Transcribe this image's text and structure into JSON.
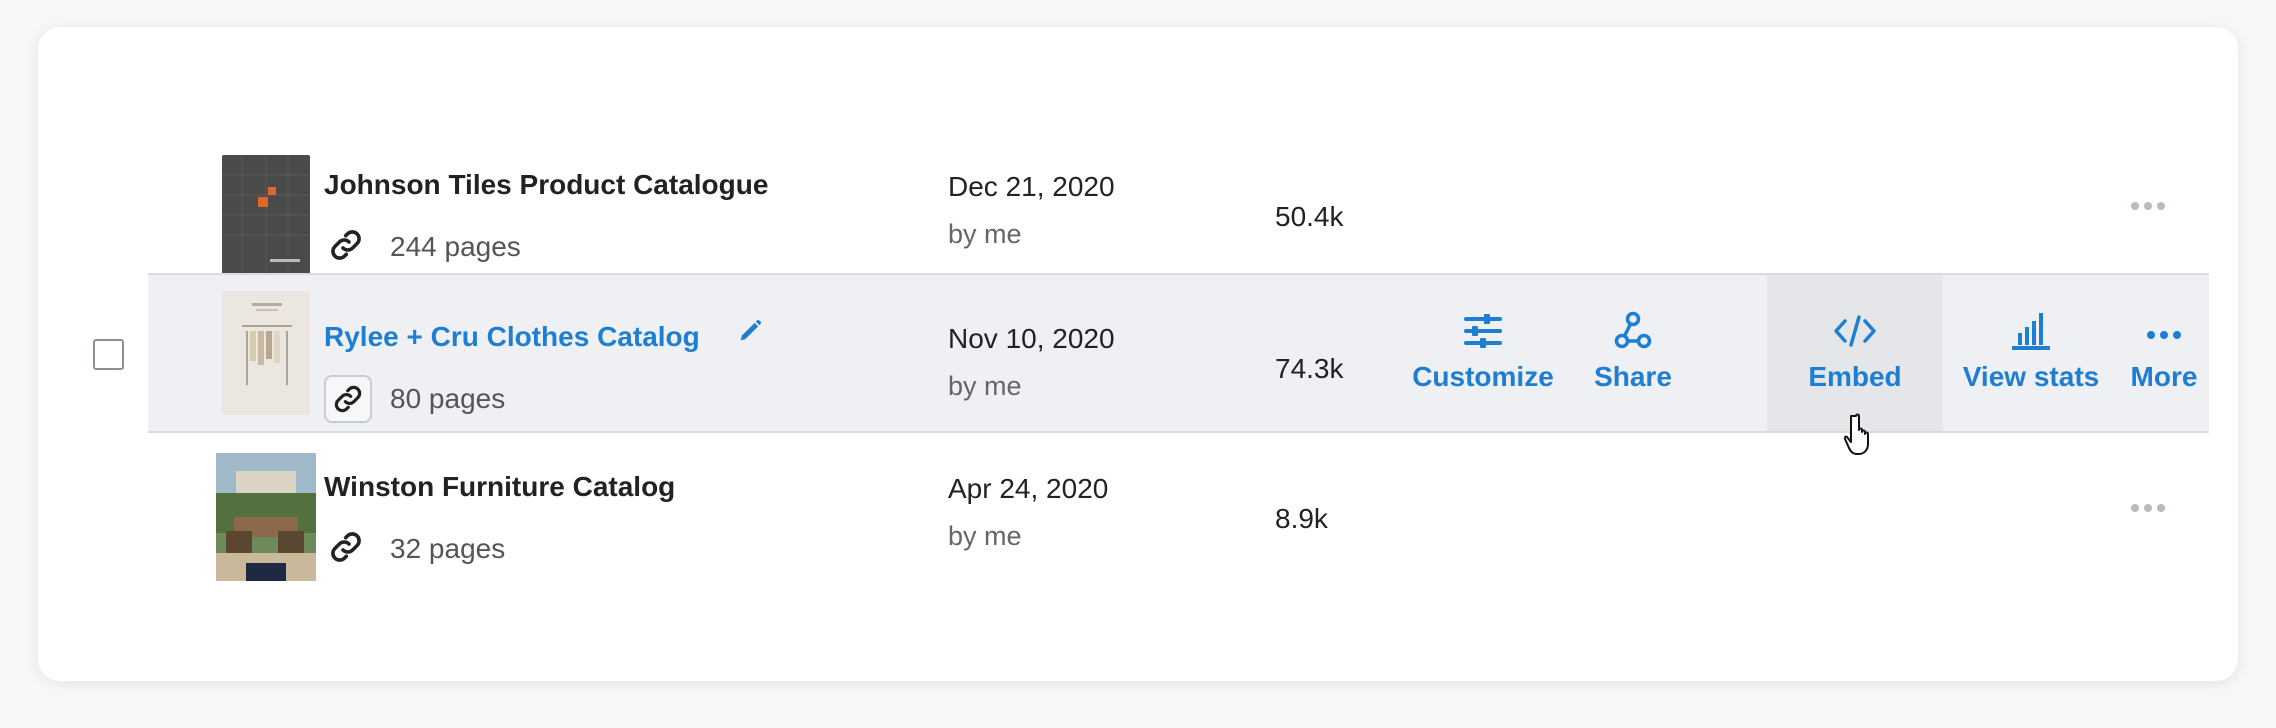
{
  "catalogs": [
    {
      "title": "Johnson Tiles Product Catalogue",
      "pages": "244 pages",
      "date": "Dec 21, 2020",
      "author": "by me",
      "views": "50.4k"
    },
    {
      "title": "Rylee + Cru Clothes Catalog",
      "pages": "80 pages",
      "date": "Nov 10, 2020",
      "author": "by me",
      "views": "74.3k"
    },
    {
      "title": "Winston Furniture Catalog",
      "pages": "32 pages",
      "date": "Apr 24, 2020",
      "author": "by me",
      "views": "8.9k"
    }
  ],
  "row_actions": {
    "customize": "Customize",
    "share": "Share",
    "embed": "Embed",
    "view_stats": "View stats",
    "more": "More"
  },
  "colors": {
    "accent": "#1e7ed1",
    "hover_row": "#eef0f4",
    "hover_action": "#e4e6ea"
  },
  "icons": [
    "link-icon",
    "edit-icon",
    "customize-sliders-icon",
    "share-icon",
    "embed-code-icon",
    "bar-chart-icon",
    "more-dots-icon",
    "hand-cursor-icon"
  ]
}
